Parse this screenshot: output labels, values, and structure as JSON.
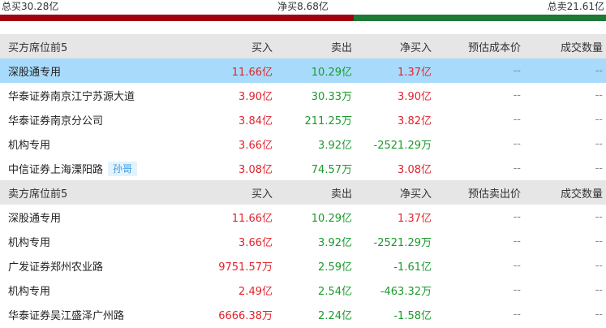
{
  "summary": {
    "total_buy": "总买30.28亿",
    "net_buy": "净买8.68亿",
    "total_sell": "总卖21.61亿",
    "buy_share": 0.584
  },
  "colors": {
    "buy_bar": "#a10010",
    "sell_bar": "#1c7a35",
    "up": "#e3232c",
    "down": "#1a9a2c",
    "highlight": "#a8dbfb"
  },
  "buy_table": {
    "headers": [
      "买方席位前5",
      "买入",
      "卖出",
      "净买入",
      "预估成本价",
      "成交数量"
    ],
    "rows": [
      {
        "name": "深股通专用",
        "buy": "11.66亿",
        "sell": "10.29亿",
        "net": "1.37亿",
        "price": "--",
        "volume": "--"
      },
      {
        "name": "华泰证券南京江宁苏源大道",
        "buy": "3.90亿",
        "sell": "30.33万",
        "net": "3.90亿",
        "price": "--",
        "volume": "--"
      },
      {
        "name": "华泰证券南京分公司",
        "buy": "3.84亿",
        "sell": "211.25万",
        "net": "3.82亿",
        "price": "--",
        "volume": "--"
      },
      {
        "name": "机构专用",
        "buy": "3.66亿",
        "sell": "3.92亿",
        "net": "-2521.29万",
        "price": "--",
        "volume": "--"
      },
      {
        "name": "中信证券上海溧阳路",
        "tag": "孙哥",
        "buy": "3.08亿",
        "sell": "74.57万",
        "net": "3.08亿",
        "price": "--",
        "volume": "--"
      }
    ]
  },
  "sell_table": {
    "headers": [
      "卖方席位前5",
      "买入",
      "卖出",
      "净买入",
      "预估卖出价",
      "成交数量"
    ],
    "rows": [
      {
        "name": "深股通专用",
        "buy": "11.66亿",
        "sell": "10.29亿",
        "net": "1.37亿",
        "price": "--",
        "volume": "--"
      },
      {
        "name": "机构专用",
        "buy": "3.66亿",
        "sell": "3.92亿",
        "net": "-2521.29万",
        "price": "--",
        "volume": "--"
      },
      {
        "name": "广发证券郑州农业路",
        "buy": "9751.57万",
        "sell": "2.59亿",
        "net": "-1.61亿",
        "price": "--",
        "volume": "--"
      },
      {
        "name": "机构专用",
        "buy": "2.49亿",
        "sell": "2.54亿",
        "net": "-463.32万",
        "price": "--",
        "volume": "--"
      },
      {
        "name": "华泰证券吴江盛泽广州路",
        "buy": "6666.38万",
        "sell": "2.24亿",
        "net": "-1.58亿",
        "price": "--",
        "volume": "--"
      }
    ]
  }
}
